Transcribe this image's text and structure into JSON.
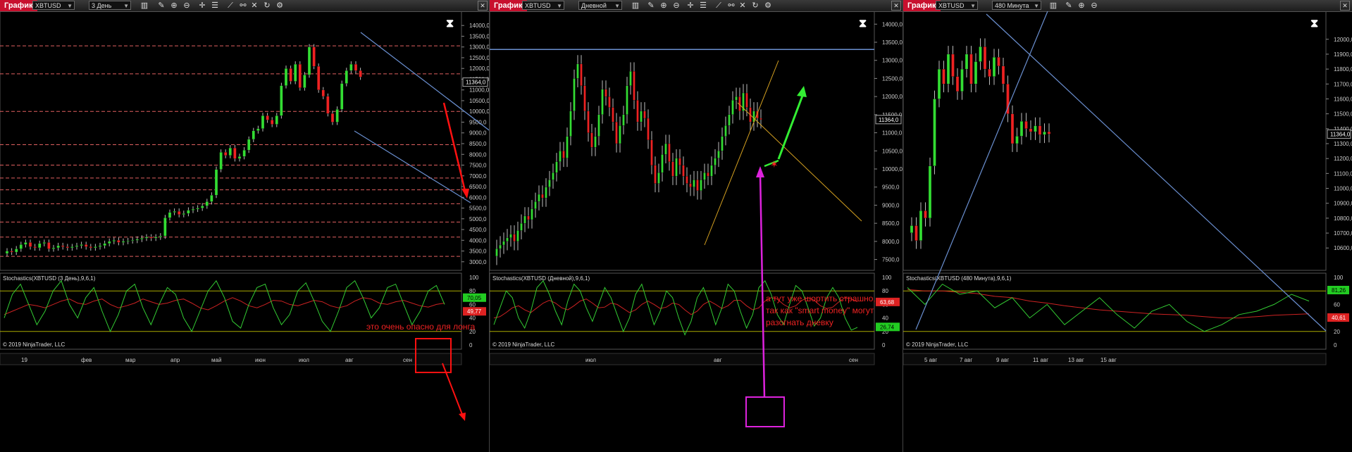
{
  "colors": {
    "up": "#33dd33",
    "down": "#ee2222",
    "level": "#e06060",
    "channel": "#6a8fd0",
    "yellow_line": "#d4a020",
    "stoch_k": "#33cc33",
    "stoch_d": "#cc2222",
    "stoch_band": "#aaaa00",
    "magenta": "#dd22dd",
    "annotation": "#ee2222",
    "title_bg": "#c8102e"
  },
  "watermark": "© 2019 NinjaTrader, LLC",
  "panels": [
    {
      "title": "График",
      "symbol": "XBTUSD",
      "interval": "3 День",
      "indicator_label": "Stochastics(XBTUSD (3 День),9,6,1)",
      "annotation": "это очень опасно для лонга"
    },
    {
      "title": "График",
      "symbol": "XBTUSD",
      "interval": "Дневной",
      "indicator_label": "Stochastics(XBTUSD (Дневной),9,6,1)",
      "annotation_lines": [
        "а тут уже шортить страшно,",
        "так как \"smart money\" могут",
        "разогнать дневку"
      ]
    },
    {
      "title": "График",
      "symbol": "XBTUSD",
      "interval": "480 Минута",
      "indicator_label": "Stochastics(XBTUSD (480 Минута),9,6,1)"
    }
  ],
  "chart_data": [
    {
      "type": "candlestick",
      "ylim": [
        2600,
        14400
      ],
      "yticks": [
        3000,
        3500,
        4000,
        4500,
        5000,
        5500,
        6000,
        6500,
        7000,
        7500,
        8000,
        8500,
        9000,
        9500,
        10000,
        10500,
        11000,
        11500,
        12000,
        12500,
        13000,
        13500,
        14000
      ],
      "ytick_labels": [
        "3000,0",
        "3500,0",
        "4000,0",
        "4500,0",
        "5000,0",
        "5500,0",
        "6000,0",
        "6500,0",
        "7000,0",
        "7500,0",
        "8000,0",
        "8500,0",
        "9000,0",
        "9500,0",
        "10000,0",
        "10500,0",
        "11000,0",
        "11500,0",
        "12000,0",
        "12500,0",
        "13000,0",
        "13500,0",
        "14000,0"
      ],
      "last_price": 11364,
      "last_price_label": "11364,0",
      "x_labels": [
        "19",
        "фев",
        "мар",
        "апр",
        "май",
        "июн",
        "июл",
        "авг",
        "сен"
      ],
      "horizontal_levels": [
        3250,
        4150,
        4850,
        5700,
        6350,
        6900,
        7500,
        8450,
        10000,
        11750,
        13050
      ],
      "closes": [
        3500,
        3450,
        3600,
        3800,
        3900,
        3700,
        3650,
        3850,
        3900,
        3600,
        3650,
        3750,
        3700,
        3650,
        3700,
        3750,
        3800,
        3700,
        3650,
        3700,
        3750,
        3850,
        3950,
        4000,
        3900,
        3950,
        3980,
        4000,
        4050,
        4100,
        4150,
        4100,
        4150,
        4200,
        5050,
        5300,
        5350,
        5200,
        5250,
        5400,
        5450,
        5500,
        5600,
        5800,
        6100,
        7300,
        8100,
        7950,
        8300,
        7800,
        7900,
        8200,
        8700,
        9100,
        9200,
        9800,
        9600,
        9400,
        9800,
        11200,
        12000,
        11400,
        12200,
        11100,
        11700,
        13000,
        12100,
        11000,
        10700,
        9900,
        9500,
        10100,
        11300,
        11900,
        12200,
        11900,
        11600
      ],
      "hl_spread": 380,
      "stochastic": {
        "ylim": [
          0,
          100
        ],
        "yticks": [
          0,
          20,
          40,
          60,
          80,
          100
        ],
        "upper_band": 80,
        "lower_band": 20,
        "k_last": 70.05,
        "k_label": "70,05",
        "d_last": 49.77,
        "d_label": "49,77",
        "k": [
          40,
          75,
          90,
          60,
          30,
          50,
          80,
          95,
          60,
          40,
          70,
          85,
          50,
          20,
          45,
          80,
          90,
          55,
          30,
          60,
          85,
          75,
          40,
          20,
          50,
          80,
          95,
          70,
          35,
          25,
          60,
          85,
          90,
          55,
          30,
          45,
          80,
          92,
          65,
          35,
          20,
          50,
          85,
          95,
          70,
          40,
          55,
          85,
          90,
          60,
          30,
          50,
          80,
          88,
          60
        ],
        "d": [
          45,
          50,
          55,
          60,
          58,
          55,
          60,
          65,
          68,
          62,
          60,
          65,
          68,
          60,
          55,
          58,
          62,
          68,
          64,
          60,
          62,
          66,
          68,
          62,
          55,
          52,
          58,
          65,
          70,
          65,
          58,
          55,
          60,
          66,
          65,
          60,
          58,
          62,
          66,
          64,
          58,
          55,
          58,
          65,
          70,
          68,
          62,
          60,
          64,
          66,
          62,
          58,
          56,
          60,
          62
        ]
      }
    },
    {
      "type": "candlestick",
      "ylim": [
        7200,
        14200
      ],
      "yticks": [
        7500,
        8000,
        8500,
        9000,
        9500,
        10000,
        10500,
        11000,
        11500,
        12000,
        12500,
        13000,
        13500,
        14000
      ],
      "ytick_labels": [
        "7500,0",
        "8000,0",
        "8500,0",
        "9000,0",
        "9500,0",
        "10000,0",
        "10500,0",
        "11000,0",
        "11500,0",
        "12000,0",
        "12500,0",
        "13000,0",
        "13500,0",
        "14000,0"
      ],
      "last_price": 11364,
      "last_price_label": "11364,0",
      "x_labels": [
        "июл",
        "авг",
        "сен"
      ],
      "horizontal_levels": [
        13300
      ],
      "closes": [
        7800,
        7900,
        8000,
        8100,
        8200,
        8000,
        8300,
        8500,
        8700,
        8600,
        8900,
        9100,
        9300,
        9200,
        9500,
        9700,
        9900,
        10200,
        10500,
        10300,
        10900,
        11600,
        12500,
        12900,
        12300,
        11600,
        11000,
        10600,
        10900,
        11500,
        12200,
        12000,
        11700,
        11300,
        10700,
        11200,
        11500,
        12300,
        12700,
        11900,
        11300,
        11600,
        11400,
        10800,
        10100,
        9600,
        9900,
        10400,
        10700,
        10200,
        9800,
        10300,
        10100,
        9800,
        9600,
        9500,
        9700,
        9400,
        9700,
        9900,
        9800,
        10100,
        10300,
        10500,
        10900,
        11200,
        11500,
        11900,
        12000,
        11600,
        12100,
        11700,
        11300,
        11600,
        11400,
        11364
      ],
      "hl_spread": 700,
      "stochastic": {
        "ylim": [
          0,
          100
        ],
        "yticks": [
          0,
          20,
          40,
          60,
          80,
          100
        ],
        "upper_band": 80,
        "lower_band": 20,
        "k_last": 26.74,
        "k_label": "26,74",
        "d_last": 63.68,
        "d_label": "63,68",
        "k": [
          30,
          55,
          80,
          70,
          40,
          25,
          50,
          85,
          95,
          75,
          50,
          30,
          65,
          90,
          80,
          55,
          35,
          60,
          85,
          70,
          45,
          20,
          40,
          75,
          90,
          60,
          30,
          50,
          80,
          70,
          40,
          15,
          35,
          70,
          85,
          60,
          30,
          55,
          90,
          80,
          50,
          25,
          45,
          85,
          95,
          75,
          45,
          30,
          60,
          88,
          80,
          55,
          28,
          40,
          70,
          85,
          70,
          40,
          22,
          26
        ],
        "d": [
          40,
          42,
          48,
          55,
          58,
          52,
          48,
          55,
          62,
          66,
          62,
          55,
          52,
          58,
          65,
          68,
          62,
          55,
          56,
          62,
          60,
          54,
          48,
          52,
          60,
          65,
          60,
          54,
          56,
          62,
          60,
          52,
          45,
          50,
          60,
          65,
          60,
          54,
          58,
          66,
          66,
          58,
          52,
          55,
          65,
          70,
          68,
          60,
          55,
          58,
          66,
          70,
          66,
          58,
          54,
          56,
          64,
          70,
          68,
          64
        ]
      }
    },
    {
      "type": "candlestick",
      "ylim": [
        10450,
        12150
      ],
      "yticks": [
        10600,
        10700,
        10800,
        10900,
        11000,
        11100,
        11200,
        11300,
        11400,
        11500,
        11600,
        11700,
        11800,
        11900,
        12000
      ],
      "ytick_labels": [
        "10600,0",
        "10700,0",
        "10800,0",
        "10900,0",
        "11000,0",
        "11100,0",
        "11200,0",
        "11300,0",
        "11400,0",
        "11500,0",
        "11600,0",
        "11700,0",
        "11800,0",
        "11900,0",
        "12000,0"
      ],
      "last_price": 11364,
      "last_price_label": "11364,0",
      "x_labels": [
        "5 авг",
        "7 авг",
        "9 авг",
        "11 авг",
        "13 авг",
        "15 авг"
      ],
      "horizontal_levels": [],
      "closes": [
        10750,
        10650,
        10850,
        10800,
        11150,
        11600,
        11800,
        11700,
        11900,
        11750,
        11650,
        11800,
        11900,
        11700,
        11850,
        11950,
        11800,
        11750,
        11880,
        11820,
        11700,
        11500,
        11300,
        11350,
        11450,
        11400,
        11380,
        11420,
        11360,
        11380,
        11364
      ],
      "hl_spread": 160,
      "stochastic": {
        "ylim": [
          0,
          100
        ],
        "yticks": [
          0,
          20,
          40,
          60,
          80,
          100
        ],
        "upper_band": 80,
        "lower_band": 20,
        "k_last": 81.26,
        "k_label": "81,26",
        "d_last": 40.61,
        "d_label": "40,61",
        "k": [
          85,
          60,
          90,
          75,
          80,
          55,
          70,
          40,
          60,
          30,
          50,
          70,
          45,
          25,
          50,
          60,
          35,
          20,
          30,
          45,
          50,
          60,
          75,
          65
        ],
        "d": [
          82,
          80,
          80,
          78,
          76,
          72,
          70,
          65,
          62,
          58,
          55,
          52,
          50,
          48,
          46,
          45,
          44,
          42,
          40,
          40,
          42,
          44,
          45,
          46
        ]
      }
    }
  ]
}
